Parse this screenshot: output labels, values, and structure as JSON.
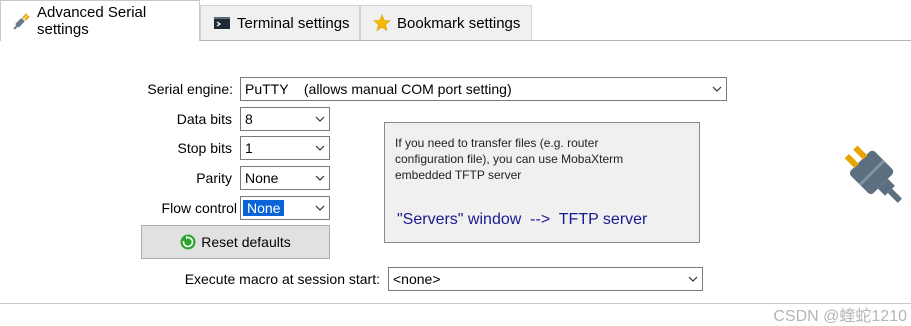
{
  "tabs": [
    {
      "label": "Advanced Serial settings",
      "icon": "serial-plug-icon",
      "active": true
    },
    {
      "label": "Terminal settings",
      "icon": "terminal-icon",
      "active": false
    },
    {
      "label": "Bookmark settings",
      "icon": "star-icon",
      "active": false
    }
  ],
  "form": {
    "serial_engine_label": "Serial engine:",
    "serial_engine_value": "PuTTY    (allows manual COM port setting)",
    "data_bits_label": "Data bits",
    "data_bits_value": "8",
    "stop_bits_label": "Stop bits",
    "stop_bits_value": "1",
    "parity_label": "Parity",
    "parity_value": "None",
    "flow_control_label": "Flow control",
    "flow_control_value": "None",
    "reset_label": "Reset defaults",
    "macro_label": "Execute macro at session start:",
    "macro_value": "<none>"
  },
  "info": {
    "text": "If you need to transfer files (e.g. router configuration file), you can use MobaXterm embedded TFTP server",
    "link": "\"Servers\" window  -->  TFTP server"
  },
  "watermark": "CSDN @蝰蛇1210",
  "colors": {
    "accent": "#0a64d8",
    "link": "#1a1a8c",
    "star": "#f5b800",
    "reset_icon": "#2aa52a"
  }
}
